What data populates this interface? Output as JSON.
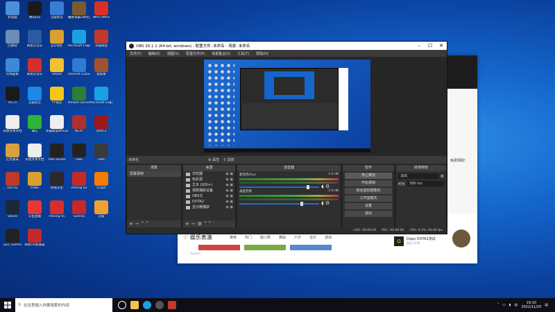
{
  "desktop_icons": [
    {
      "label": "此电脑",
      "color": "#4a90d9"
    },
    {
      "label": "腾讯QQ",
      "color": "#1a1a1a"
    },
    {
      "label": "迅雷影音",
      "color": "#3a7bd5"
    },
    {
      "label": "魔兽争霸3冰封王座",
      "color": "#7a5a30"
    },
    {
      "label": "WPS Office",
      "color": "#d93025"
    },
    {
      "label": "回收站",
      "color": "#6a8db5"
    },
    {
      "label": "网易云音乐",
      "color": "#2a5aa0"
    },
    {
      "label": "JJ斗地主",
      "color": "#d8a030"
    },
    {
      "label": "Microsoft Edge",
      "color": "#1ba1e2"
    },
    {
      "label": "英雄联盟",
      "color": "#c0392b"
    },
    {
      "label": "控制面板",
      "color": "#3a8ad8"
    },
    {
      "label": "网易云音乐",
      "color": "#d32f2f"
    },
    {
      "label": "Steam",
      "color": "#f0c030"
    },
    {
      "label": "Internet Explorer",
      "color": "#2c7cd6"
    },
    {
      "label": "楚留香",
      "color": "#a0522d"
    },
    {
      "label": "ACCA",
      "color": "#1a1a1a"
    },
    {
      "label": "迅雷影音",
      "color": "#1e88e5"
    },
    {
      "label": "YY语音",
      "color": "#f5c518"
    },
    {
      "label": "NVIDIA GeForce",
      "color": "#2e7d32"
    },
    {
      "label": "Microsoft Edge",
      "color": "#1ba1e2"
    },
    {
      "label": "新建文本文档",
      "color": "#eeeeee"
    },
    {
      "label": "微信",
      "color": "#2db43b"
    },
    {
      "label": "英雄联盟WeGame",
      "color": "#eeeeee"
    },
    {
      "label": "NEXT",
      "color": "#b03030"
    },
    {
      "label": "Dota 2",
      "color": "#9a1a1a"
    },
    {
      "label": "红色警戒",
      "color": "#d9a040"
    },
    {
      "label": "新建文本文档",
      "color": "#eeeeee"
    },
    {
      "label": "OBS Studio",
      "color": "#222222"
    },
    {
      "label": "OBS",
      "color": "#222222"
    },
    {
      "label": "OBS",
      "color": "#3a3a3a"
    },
    {
      "label": "DOTA2",
      "color": "#c0392b"
    },
    {
      "label": "PUBG",
      "color": "#d9a030"
    },
    {
      "label": "绝地求生",
      "color": "#2a2a2a"
    },
    {
      "label": "Among Us",
      "color": "#c62828"
    },
    {
      "label": "Origin",
      "color": "#f57c00"
    },
    {
      "label": "Steam",
      "color": "#1b2838"
    },
    {
      "label": "斗鱼直播",
      "color": "#e53935"
    },
    {
      "label": "Among Us",
      "color": "#d32f2f"
    },
    {
      "label": "Garena",
      "color": "#c62828"
    },
    {
      "label": "迅雷",
      "color": "#f0a030"
    },
    {
      "label": "Epic Games",
      "color": "#222222"
    },
    {
      "label": "网易UU加速器",
      "color": "#c62828"
    }
  ],
  "browser": {
    "section_title": "娱乐表演",
    "tabs": [
      "推荐",
      "热门",
      "脱口秀",
      "舞蹈",
      "户外",
      "音乐",
      "游戏"
    ],
    "side_text": "免费领取!",
    "recommend_name": "Dopo DOTA2测试",
    "recommend_sub": "关注 1235",
    "bottom_input": "Aurora"
  },
  "obs": {
    "title": "OBS 26.1.1 (64-bit, windows) - 配置文件: 未命名 - 场景: 未命名",
    "menu": [
      "文件(F)",
      "编辑(E)",
      "视图(V)",
      "配置文件(P)",
      "场景集合(S)",
      "工具(T)",
      "帮助(H)"
    ],
    "scene_label": "未命名",
    "scene_tools": [
      "属性",
      "滤镜"
    ],
    "docks": {
      "scenes": {
        "title": "场景",
        "items": [
          "屏幕录制"
        ]
      },
      "sources": {
        "title": "来源",
        "items": [
          "浏览器",
          "色彩源",
          "文本 (GDI+)",
          "视频捕获设备",
          "OBS文",
          "DOTA2",
          "显示器捕获"
        ]
      },
      "mixer": {
        "title": "混音器",
        "tracks": [
          {
            "name": "麦克风/Aux",
            "db": "-1.0 dB",
            "level": 0.86
          },
          {
            "name": "桌面音频",
            "db": "-1.0 dB",
            "level": 0.78
          }
        ]
      },
      "controls": {
        "title": "控件",
        "buttons": [
          "停止推流",
          "开始录制",
          "启动虚拟摄像机",
          "工作室模式",
          "设置",
          "退出"
        ]
      },
      "transitions": {
        "title": "转场特效",
        "type": "淡出",
        "duration_label": "时长",
        "duration": "300 ms"
      }
    },
    "status": [
      "LIVE: 00:00:00",
      "REC: 00:00:00",
      "CPU: 0.3%, 60.00 fps"
    ]
  },
  "taskbar": {
    "search_placeholder": "在这里输入你要搜索的内容",
    "time": "19:10",
    "date": "2021/11/20",
    "ime": "中"
  }
}
